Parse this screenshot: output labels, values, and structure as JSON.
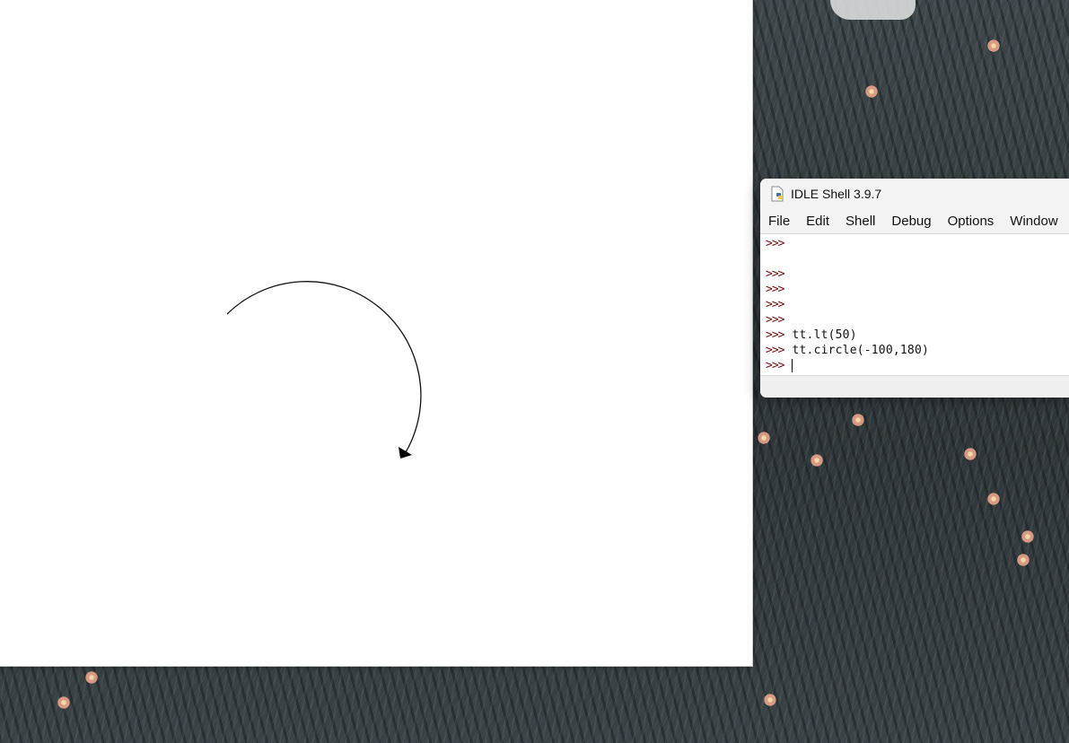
{
  "idle": {
    "title": "IDLE Shell 3.9.7",
    "menu": [
      "File",
      "Edit",
      "Shell",
      "Debug",
      "Options",
      "Window"
    ],
    "lines": [
      {
        "prompt": ">>>",
        "code": ""
      },
      {
        "prompt": "",
        "code": ""
      },
      {
        "prompt": ">>>",
        "code": ""
      },
      {
        "prompt": ">>>",
        "code": ""
      },
      {
        "prompt": ">>>",
        "code": ""
      },
      {
        "prompt": ">>>",
        "code": ""
      },
      {
        "prompt": ">>>",
        "code": "tt.lt(50)"
      },
      {
        "prompt": ">>>",
        "code": "tt.circle(-100,180)"
      },
      {
        "prompt": ">>>",
        "code": ""
      }
    ]
  },
  "turtle": {
    "pen_color": "#111111",
    "turtle_shape": "classic-arrow-icon"
  },
  "colors": {
    "prompt": "#701010",
    "canvas_bg": "#ffffff"
  }
}
